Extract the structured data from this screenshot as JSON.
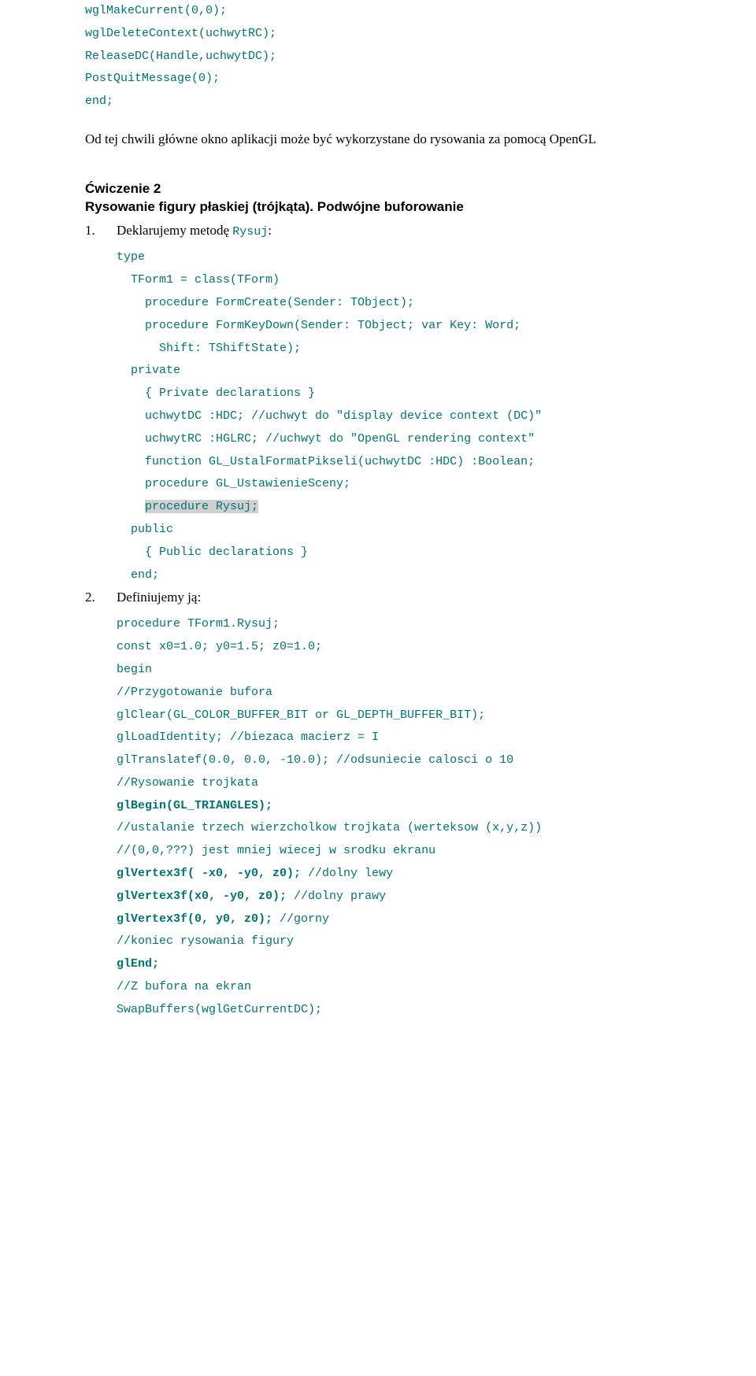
{
  "top_code": {
    "l1": "wglMakeCurrent(0,0);",
    "l2": "wglDeleteContext(uchwytRC);",
    "l3": "ReleaseDC(Handle,uchwytDC);",
    "l4": "PostQuitMessage(0);",
    "l5": "end;"
  },
  "para1": "Od tej chwili główne okno aplikacji może być wykorzystane do rysowania za pomocą OpenGL",
  "heading": "Ćwiczenie 2\nRysowanie figury płaskiej (trójkąta). Podwójne buforowanie",
  "item1": {
    "num": "1.",
    "text_before": "Deklarujemy metodę ",
    "code_token": "Rysuj",
    "text_after": ":",
    "code": {
      "l1": "type",
      "l2": "  TForm1 = class(TForm)",
      "l3": "    procedure FormCreate(Sender: TObject);",
      "l4": "    procedure FormKeyDown(Sender: TObject; var Key: Word;",
      "l5": "      Shift: TShiftState);",
      "l6": "  private",
      "l7": "    { Private declarations }",
      "l8": "    uchwytDC :HDC; //uchwyt do \"display device context (DC)\"",
      "l9": "    uchwytRC :HGLRC; //uchwyt do \"OpenGL rendering context\"",
      "l10": "    function GL_UstalFormatPikseli(uchwytDC :HDC) :Boolean;",
      "l11": "    procedure GL_UstawienieSceny;",
      "l12_pre": "    ",
      "l12_hl": "procedure Rysuj;",
      "l13": "  public",
      "l14": "    { Public declarations }",
      "l15": "  end;"
    }
  },
  "item2": {
    "num": "2.",
    "text": "Definiujemy ją:",
    "code": {
      "l1": "procedure TForm1.Rysuj;",
      "l2": "const x0=1.0; y0=1.5; z0=1.0;",
      "l3": "begin",
      "l4": "//Przygotowanie bufora",
      "l5": "glClear(GL_COLOR_BUFFER_BIT or GL_DEPTH_BUFFER_BIT);",
      "l6": "glLoadIdentity; //biezaca macierz = I",
      "l7": "glTranslatef(0.0, 0.0, -10.0); //odsuniecie calosci o 10",
      "l8": "//Rysowanie trojkata",
      "l9": "glBegin(GL_TRIANGLES);",
      "l10": "//ustalanie trzech wierzcholkow trojkata (werteksow (x,y,z))",
      "l11": "//(0,0,???) jest mniej wiecej w srodku ekranu",
      "l12_b": "glVertex3f( -x0, -y0, z0);",
      "l12_r": " //dolny lewy",
      "l13_b": "glVertex3f(x0, -y0, z0);",
      "l13_r": " //dolny prawy",
      "l14_b": "glVertex3f(0, y0, z0);",
      "l14_r": " //gorny",
      "l15": "//koniec rysowania figury",
      "l16": "glEnd;",
      "l17": "//Z bufora na ekran",
      "l18": "SwapBuffers(wglGetCurrentDC);"
    }
  }
}
